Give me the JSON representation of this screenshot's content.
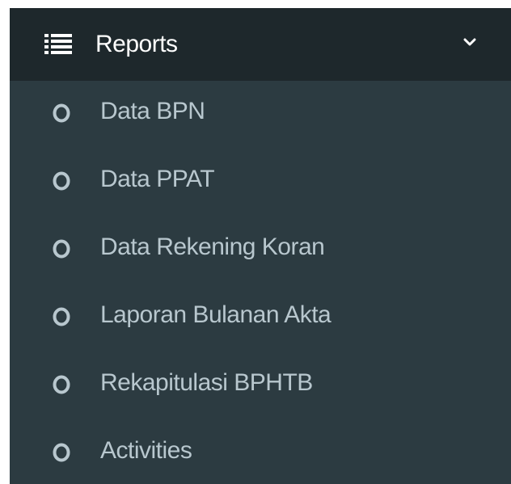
{
  "menu": {
    "title": "Reports",
    "icon": "list-icon",
    "toggle_icon": "chevron-down-icon",
    "colors": {
      "header_bg": "#1e282c",
      "submenu_bg": "#2c3b41",
      "header_text": "#ffffff",
      "item_text": "#b8c7ce"
    },
    "items": [
      {
        "label": "Data BPN",
        "icon": "circle-outline-icon"
      },
      {
        "label": "Data PPAT",
        "icon": "circle-outline-icon"
      },
      {
        "label": "Data Rekening Koran",
        "icon": "circle-outline-icon"
      },
      {
        "label": "Laporan Bulanan Akta",
        "icon": "circle-outline-icon"
      },
      {
        "label": "Rekapitulasi BPHTB",
        "icon": "circle-outline-icon"
      },
      {
        "label": "Activities",
        "icon": "circle-outline-icon"
      }
    ]
  }
}
